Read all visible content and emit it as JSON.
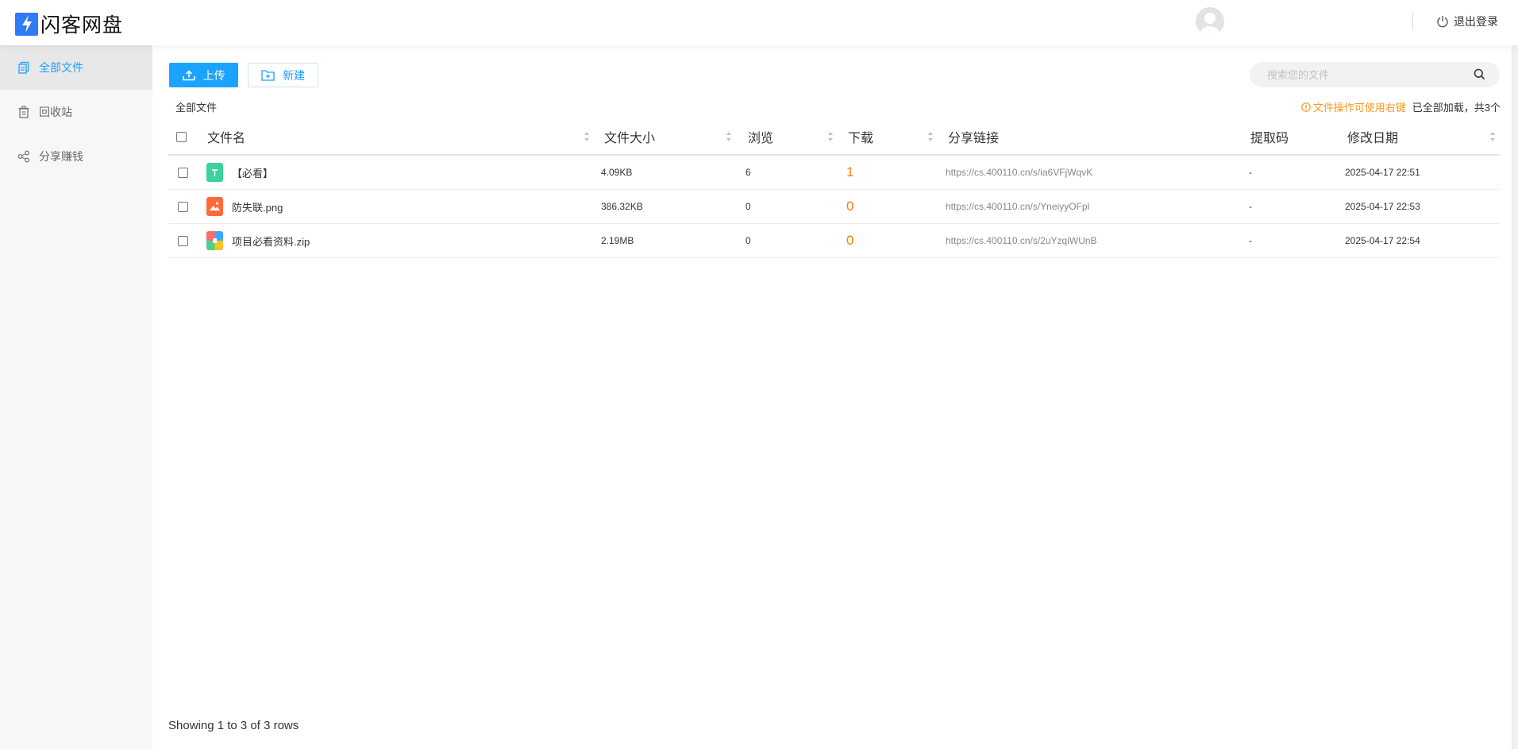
{
  "app": {
    "name": "闪客网盘"
  },
  "header": {
    "logout_label": "退出登录"
  },
  "sidebar": {
    "items": [
      {
        "label": "全部文件",
        "icon": "files-icon",
        "active": true
      },
      {
        "label": "回收站",
        "icon": "trash-icon",
        "active": false
      },
      {
        "label": "分享赚钱",
        "icon": "share-icon",
        "active": false
      }
    ]
  },
  "toolbar": {
    "upload_label": "上传",
    "new_label": "新建"
  },
  "search": {
    "placeholder": "搜索您的文件",
    "value": ""
  },
  "breadcrumb": "全部文件",
  "tip": {
    "warning": "文件操作可使用右键",
    "loaded": "已全部加载，共3个"
  },
  "table": {
    "columns": [
      "文件名",
      "文件大小",
      "浏览",
      "下载",
      "分享链接",
      "提取码",
      "修改日期"
    ],
    "rows": [
      {
        "name": "【必看】",
        "type": "text",
        "size": "4.09KB",
        "views": "6",
        "downloads": "1",
        "link": "https://cs.400110.cn/s/ia6VFjWqvK",
        "code": "-",
        "modified": "2025-04-17 22:51"
      },
      {
        "name": "防失联.png",
        "type": "image",
        "size": "386.32KB",
        "views": "0",
        "downloads": "0",
        "link": "https://cs.400110.cn/s/YneiyyOFpl",
        "code": "-",
        "modified": "2025-04-17 22:53"
      },
      {
        "name": "项目必看资料.zip",
        "type": "zip",
        "size": "2.19MB",
        "views": "0",
        "downloads": "0",
        "link": "https://cs.400110.cn/s/2uYzqiWUnB",
        "code": "-",
        "modified": "2025-04-17 22:54"
      }
    ]
  },
  "pagination": {
    "summary": "Showing 1 to 3 of 3 rows"
  },
  "colors": {
    "accent": "#1e9fff",
    "upload_button": "#1aa3ff",
    "download_count": "#ff7f00",
    "warning": "#f59a23",
    "logo": "#2f7bf5"
  }
}
